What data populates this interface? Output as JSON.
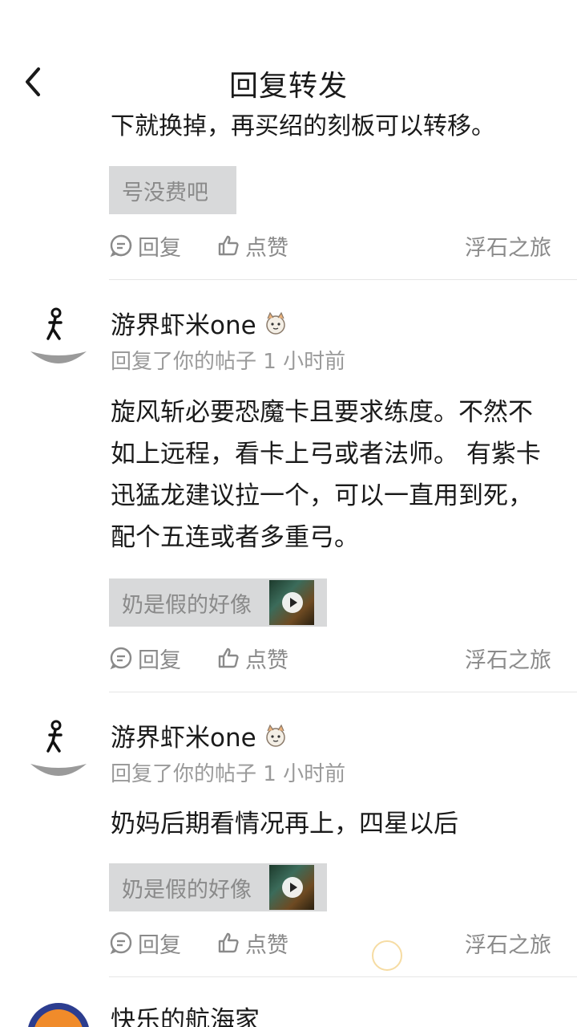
{
  "header": {
    "title": "回复转发"
  },
  "partial_comment": {
    "text": "下就换掉，再买绍的刻板可以转移。",
    "quote": "号没费吧",
    "actions": {
      "reply": "回复",
      "like": "点赞",
      "source": "浮石之旅"
    }
  },
  "comments": [
    {
      "username": "游界虾米one",
      "meta": "回复了你的帖子 1 小时前",
      "content": "旋风斩必要恐魔卡且要求练度。不然不如上远程，看卡上弓或者法师。 有紫卡迅猛龙建议拉一个，可以一直用到死，配个五连或者多重弓。",
      "quote": "奶是假的好像",
      "actions": {
        "reply": "回复",
        "like": "点赞",
        "source": "浮石之旅"
      }
    },
    {
      "username": "游界虾米one",
      "meta": "回复了你的帖子 1 小时前",
      "content": "奶妈后期看情况再上，四星以后",
      "quote": "奶是假的好像",
      "actions": {
        "reply": "回复",
        "like": "点赞",
        "source": "浮石之旅"
      }
    },
    {
      "username": "快乐的航海家"
    }
  ]
}
